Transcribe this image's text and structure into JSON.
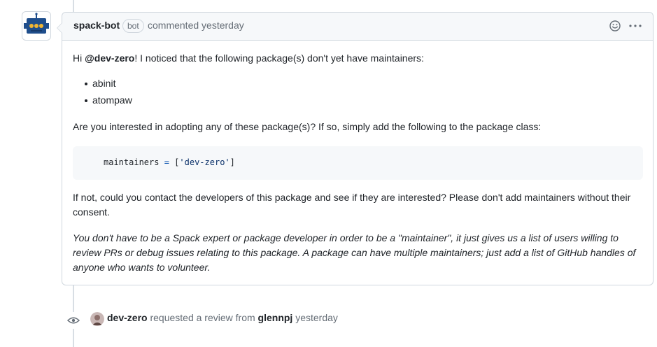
{
  "comment": {
    "author": "spack-bot",
    "badge": "bot",
    "action_time": "commented yesterday",
    "greeting_prefix": "Hi ",
    "mention": "@dev-zero",
    "greeting_suffix": "! I noticed that the following package(s) don't yet have maintainers:",
    "packages": [
      "abinit",
      "atompaw"
    ],
    "question": "Are you interested in adopting any of these package(s)? If so, simply add the following to the package class:",
    "code": {
      "var": "maintainers",
      "op": " = ",
      "open": "[",
      "value": "'dev-zero'",
      "close": "]"
    },
    "if_not": "If not, could you contact the developers of this package and see if they are interested? Please don't add maintainers without their consent.",
    "note": "You don't have to be a Spack expert or package developer in order to be a \"maintainer\", it just gives us a list of users willing to review PRs or debug issues relating to this package. A package can have multiple maintainers; just add a list of GitHub handles of anyone who wants to volunteer."
  },
  "event": {
    "actor": "dev-zero",
    "action": " requested a review from ",
    "reviewer": "glennpj",
    "time": " yesterday"
  },
  "icons": {
    "avatar": "robot-avatar",
    "reaction": "smiley-icon",
    "menu": "kebab-icon",
    "event": "eye-icon"
  },
  "colors": {
    "border": "#d0d7de",
    "header_bg": "#f6f8fa",
    "muted_text": "#656d76",
    "robot_blue": "#1f4e8c",
    "robot_eye": "#f2b632"
  }
}
